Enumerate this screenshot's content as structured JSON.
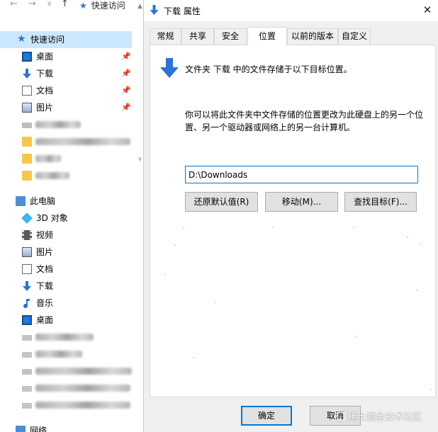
{
  "explorer": {
    "breadcrumb": "快速访问",
    "nav_back": "←",
    "nav_forward": "→",
    "nav_dropdown": "∨",
    "nav_up": "↑",
    "quick_access": {
      "label": "快速访问",
      "items": [
        {
          "label": "桌面",
          "icon": "desktop-icon",
          "pinned": true
        },
        {
          "label": "下载",
          "icon": "download-icon",
          "pinned": true
        },
        {
          "label": "文档",
          "icon": "document-icon",
          "pinned": true
        },
        {
          "label": "图片",
          "icon": "picture-icon",
          "pinned": true
        }
      ]
    },
    "this_pc": {
      "label": "此电脑",
      "items": [
        {
          "label": "3D 对象",
          "icon": "3d-objects-icon"
        },
        {
          "label": "视频",
          "icon": "video-icon"
        },
        {
          "label": "图片",
          "icon": "picture-icon"
        },
        {
          "label": "文档",
          "icon": "document-icon"
        },
        {
          "label": "下载",
          "icon": "download-icon"
        },
        {
          "label": "音乐",
          "icon": "music-icon"
        },
        {
          "label": "桌面",
          "icon": "desktop-icon"
        }
      ]
    },
    "network": {
      "label": "网络",
      "icon": "network-icon"
    },
    "pin_glyph": "📌"
  },
  "dialog": {
    "title": "下载 属性",
    "close_glyph": "✕",
    "tabs": [
      {
        "label": "常规",
        "active": false
      },
      {
        "label": "共享",
        "active": false
      },
      {
        "label": "安全",
        "active": false
      },
      {
        "label": "位置",
        "active": true
      },
      {
        "label": "以前的版本",
        "active": false
      },
      {
        "label": "自定义",
        "active": false
      }
    ],
    "location": {
      "header": "文件夹 下载 中的文件存储于以下目标位置。",
      "description": "你可以将此文件夹中文件存储的位置更改为此硬盘上的另一个位置、另一个驱动器或网络上的另一台计算机。",
      "path_value": "D:\\Downloads",
      "restore_default_label": "还原默认值(R)",
      "move_label": "移动(M)...",
      "find_target_label": "查找目标(F)..."
    },
    "footer": {
      "ok_label": "确定",
      "cancel_label": "取消"
    }
  },
  "watermark": "稀土掘金技术社区",
  "colors": {
    "accent": "#0078d7",
    "selected_row": "#cce8ff",
    "download_arrow": "#2b73d9"
  }
}
